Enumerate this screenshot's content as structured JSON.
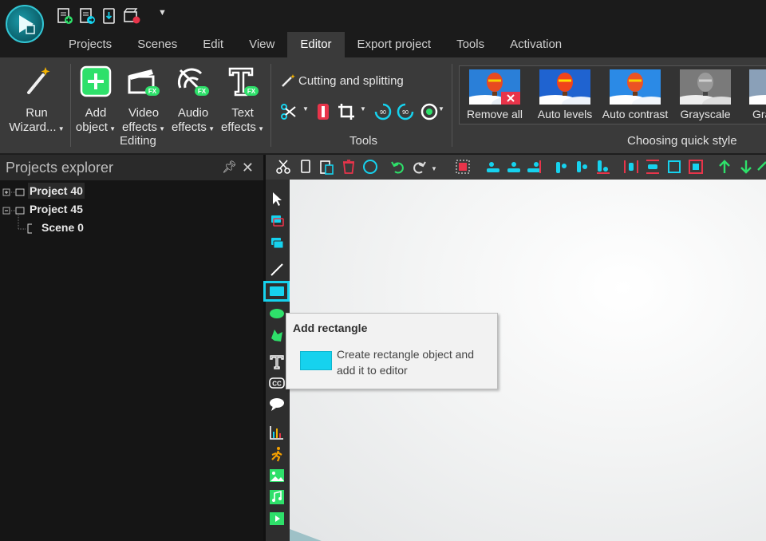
{
  "menu": {
    "tabs": [
      "Projects",
      "Scenes",
      "Edit",
      "View",
      "Editor",
      "Export project",
      "Tools",
      "Activation"
    ],
    "active_tab": "Editor"
  },
  "ribbon": {
    "run_wizard": [
      "Run",
      "Wizard..."
    ],
    "add_object": [
      "Add",
      "object"
    ],
    "video_effects": [
      "Video",
      "effects"
    ],
    "audio_effects": [
      "Audio",
      "effects"
    ],
    "text_effects": [
      "Text",
      "effects"
    ],
    "editing_label": "Editing",
    "cutting_label": "Cutting and splitting",
    "tools_label": "Tools",
    "quick_style_label": "Choosing quick style",
    "styles": [
      "Remove all",
      "Auto levels",
      "Auto contrast",
      "Grayscale",
      "Gra"
    ],
    "fx_badge": "FX",
    "rot_90": "90"
  },
  "explorer": {
    "title": "Projects explorer",
    "items": [
      {
        "label": "Project 40"
      },
      {
        "label": "Project 45"
      },
      {
        "label": "Scene 0"
      }
    ]
  },
  "tooltip": {
    "title": "Add rectangle",
    "description": "Create rectangle object and add it to editor"
  },
  "colors": {
    "accent": "#16d2ee",
    "green": "#2ee06a",
    "red": "#e8344a"
  }
}
